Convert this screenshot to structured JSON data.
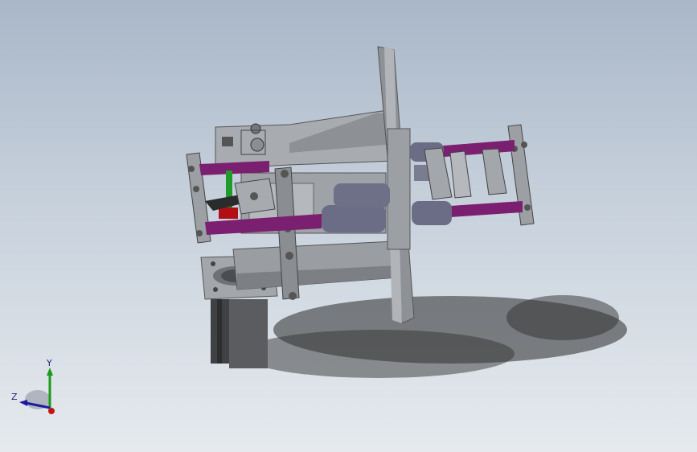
{
  "viewport": {
    "background_top": "#a9b7c8",
    "background_bottom": "#e6eaee"
  },
  "model": {
    "part_color": "#a3a6aa",
    "part_shade": "#8a8d91",
    "rod_color": "#7b1f70",
    "roller_color": "#6b6d86",
    "green_rod": "#1f9a2b",
    "red_part": "#b10f14"
  },
  "triad": {
    "y_label": "Y",
    "z_label": "Z",
    "y_color": "#1b9b1b",
    "z_color": "#1c1c9e",
    "x_color": "#c31414"
  }
}
